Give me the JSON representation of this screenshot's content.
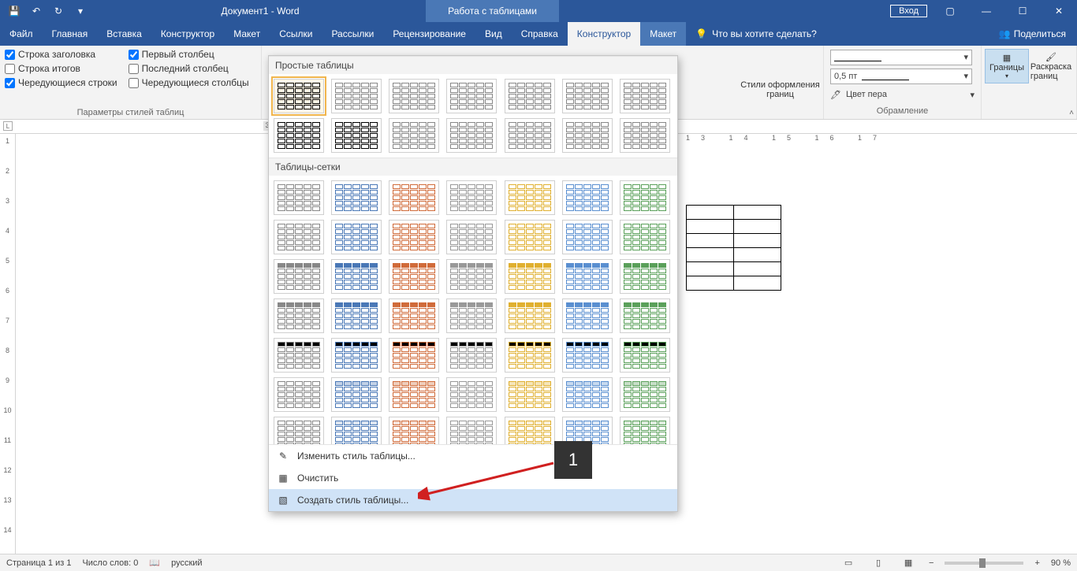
{
  "titlebar": {
    "doc_title": "Документ1 - Word",
    "context_title": "Работа с таблицами",
    "login": "Вход"
  },
  "tabs": {
    "file": "Файл",
    "home": "Главная",
    "insert": "Вставка",
    "design": "Конструктор",
    "layout": "Макет",
    "references": "Ссылки",
    "mailings": "Рассылки",
    "review": "Рецензирование",
    "view": "Вид",
    "help": "Справка",
    "table_design": "Конструктор",
    "table_layout": "Макет",
    "tell_me": "Что вы хотите сделать?",
    "share": "Поделиться"
  },
  "options_group": {
    "header_row": "Строка заголовка",
    "total_row": "Строка итогов",
    "banded_rows": "Чередующиеся строки",
    "first_col": "Первый столбец",
    "last_col": "Последний столбец",
    "banded_cols": "Чередующиеся столбцы",
    "label": "Параметры стилей таблиц",
    "checked": {
      "header_row": true,
      "total_row": false,
      "banded_rows": true,
      "first_col": true,
      "last_col": false,
      "banded_cols": false
    }
  },
  "gallery": {
    "section_plain": "Простые таблицы",
    "section_grid": "Таблицы-сетки",
    "menu_modify": "Изменить стиль таблицы...",
    "menu_clear": "Очистить",
    "menu_new": "Создать стиль таблицы..."
  },
  "border_styles": {
    "label_styles": "Стили оформления границ",
    "pen_weight": "0,5 пт",
    "pen_color": "Цвет пера",
    "borders_btn": "Границы",
    "painter_btn": "Раскраска границ",
    "group_label": "Обрамление"
  },
  "ruler_marks": [
    "13",
    "14",
    "15",
    "16",
    "17"
  ],
  "ruler_v_marks": [
    "",
    "1",
    "2",
    "3",
    "4",
    "5",
    "6",
    "7",
    "8",
    "9",
    "10",
    "11",
    "12",
    "13",
    "14"
  ],
  "annotation": {
    "number": "1"
  },
  "statusbar": {
    "page": "Страница 1 из 1",
    "words": "Число слов: 0",
    "lang": "русский",
    "zoom": "90 %"
  }
}
